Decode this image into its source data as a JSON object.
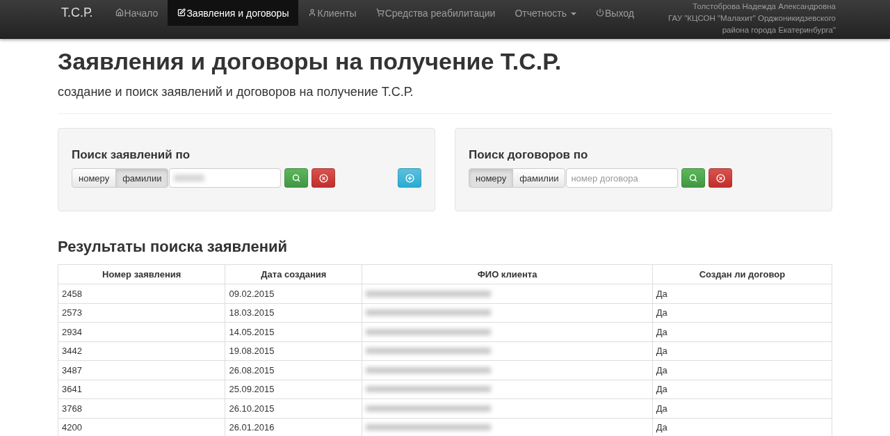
{
  "navbar": {
    "brand": "Т.С.Р.",
    "items": [
      {
        "label": "Начало",
        "kind": "link",
        "selected": false
      },
      {
        "label": "Заявления и договоры",
        "kind": "link",
        "selected": true
      },
      {
        "label": "Клиенты",
        "kind": "link",
        "selected": false
      },
      {
        "label": "Средства реабилитации",
        "kind": "link",
        "selected": false
      },
      {
        "label": "Отчетность",
        "kind": "dropdown",
        "selected": false
      },
      {
        "label": "Выход",
        "kind": "link",
        "selected": false
      }
    ],
    "user_lines": [
      "Толстоброва Надежда Александровна",
      "ГАУ \"КЦСОН \"Малахит\" Орджоникидзевского",
      "района города Екатеринбурга\""
    ]
  },
  "page": {
    "title": "Заявления и договоры на получение Т.С.Р.",
    "subtitle": "создание и поиск заявлений и договоров на получение Т.С.Р."
  },
  "search_panels": [
    {
      "title": "Поиск заявлений по",
      "modes": [
        {
          "label": "номеру",
          "selected": false
        },
        {
          "label": "фамилии",
          "selected": true
        }
      ],
      "value_redacted": true,
      "add_button": true
    },
    {
      "title": "Поиск договоров по",
      "modes": [
        {
          "label": "номеру",
          "selected": true
        },
        {
          "label": "фамилии",
          "selected": false
        }
      ],
      "placeholder": "номер договора",
      "add_button": false
    }
  ],
  "results": {
    "title": "Результаты поиска заявлений",
    "columns": [
      "Номер заявления",
      "Дата создания",
      "ФИО клиента",
      "Создан ли договор"
    ],
    "rows": [
      {
        "number": "2458",
        "date": "09.02.2015",
        "contract": "Да"
      },
      {
        "number": "2573",
        "date": "18.03.2015",
        "contract": "Да"
      },
      {
        "number": "2934",
        "date": "14.05.2015",
        "contract": "Да"
      },
      {
        "number": "3442",
        "date": "19.08.2015",
        "contract": "Да"
      },
      {
        "number": "3487",
        "date": "26.08.2015",
        "contract": "Да"
      },
      {
        "number": "3641",
        "date": "25.09.2015",
        "contract": "Да"
      },
      {
        "number": "3768",
        "date": "26.10.2015",
        "contract": "Да"
      },
      {
        "number": "4200",
        "date": "26.01.2016",
        "contract": "Да"
      }
    ]
  }
}
